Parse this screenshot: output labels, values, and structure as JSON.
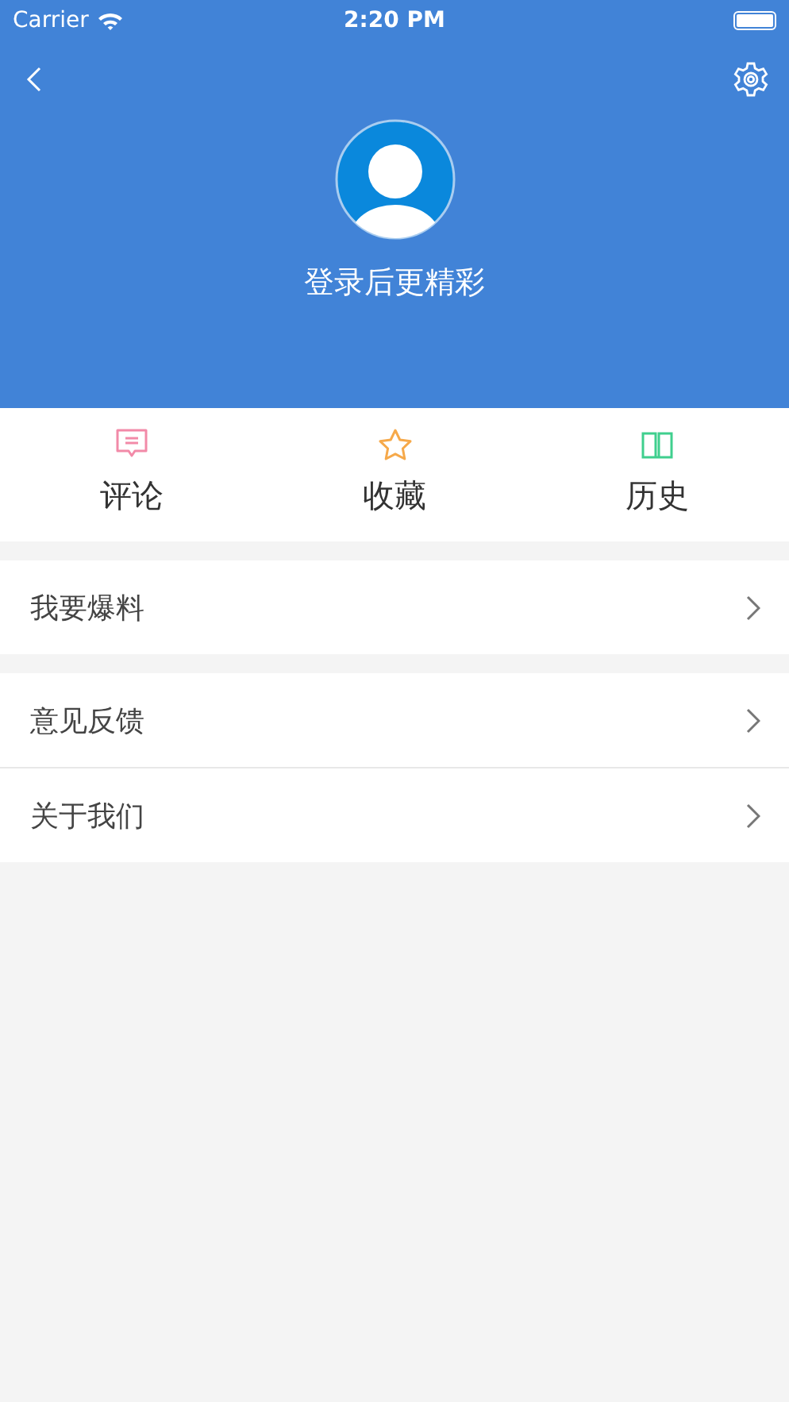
{
  "status_bar": {
    "carrier": "Carrier",
    "time": "2:20 PM"
  },
  "header": {
    "login_prompt": "登录后更精彩"
  },
  "shortcuts": [
    {
      "label": "评论",
      "kind": "comment",
      "color": "#f28aa8"
    },
    {
      "label": "收藏",
      "kind": "star",
      "color": "#f6a94a"
    },
    {
      "label": "历史",
      "kind": "book",
      "color": "#3fcf8e"
    }
  ],
  "menu_groups": [
    {
      "items": [
        {
          "label": "我要爆料"
        }
      ]
    },
    {
      "items": [
        {
          "label": "意见反馈"
        },
        {
          "label": "关于我们"
        }
      ]
    }
  ]
}
